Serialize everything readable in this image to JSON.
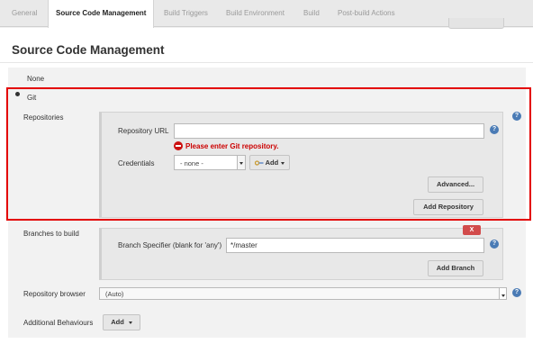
{
  "tabs": {
    "general": "General",
    "scm": "Source Code Management",
    "triggers": "Build Triggers",
    "environment": "Build Environment",
    "build": "Build",
    "post_build": "Post-build Actions"
  },
  "section": {
    "title": "Source Code Management"
  },
  "scm_options": {
    "none": "None",
    "git": "Git"
  },
  "repositories": {
    "label": "Repositories",
    "url_label": "Repository URL",
    "url_value": "",
    "error": "Please enter Git repository.",
    "credentials_label": "Credentials",
    "credentials_value": "- none -",
    "add_label": "Add",
    "advanced_label": "Advanced...",
    "add_repository_label": "Add Repository"
  },
  "branches": {
    "label": "Branches to build",
    "delete_label": "X",
    "specifier_label": "Branch Specifier (blank for 'any')",
    "specifier_value": "*/master",
    "add_branch_label": "Add Branch"
  },
  "repo_browser": {
    "label": "Repository browser",
    "value": "(Auto)"
  },
  "behaviours": {
    "label": "Additional Behaviours",
    "add_label": "Add"
  },
  "help_glyph": "?",
  "colors": {
    "highlight": "#e30000",
    "error": "#cc0000",
    "help": "#4a7bb5",
    "delete": "#d24b4b"
  },
  "icons": [
    "help-icon",
    "error-icon",
    "key-icon",
    "chevron-down-icon",
    "close-icon"
  ]
}
